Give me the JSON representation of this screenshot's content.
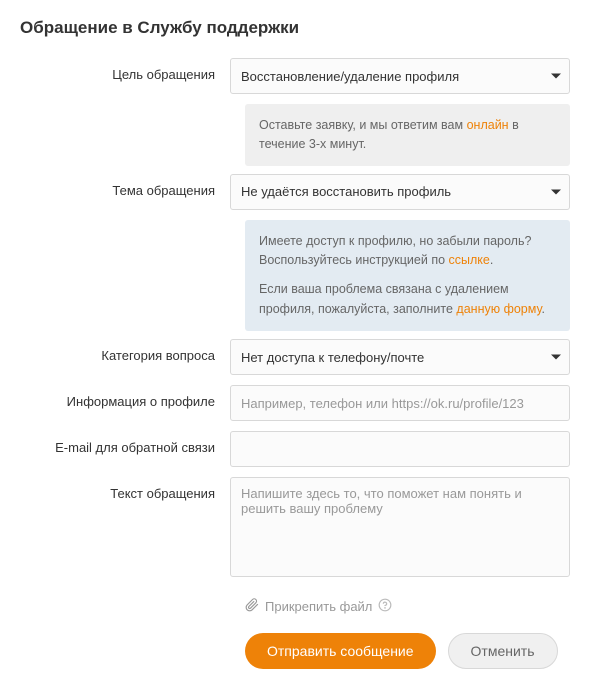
{
  "title": "Обращение в Службу поддержки",
  "fields": {
    "purpose": {
      "label": "Цель обращения",
      "value": "Восстановление/удаление профиля"
    },
    "purpose_note": {
      "text1": "Оставьте заявку, и мы ответим вам ",
      "link": "онлайн",
      "text2": " в течение 3-х минут."
    },
    "subject": {
      "label": "Тема обращения",
      "value": "Не удаётся восстановить профиль"
    },
    "subject_note": {
      "p1a": "Имеете доступ к профилю, но забыли пароль? Воспользуйтесь инструкцией по ",
      "p1link": "ссылке",
      "p1b": ".",
      "p2a": "Если ваша проблема связана с удалением профиля, пожалуйста, заполните ",
      "p2link": "данную форму",
      "p2b": "."
    },
    "category": {
      "label": "Категория вопроса",
      "value": "Нет доступа к телефону/почте"
    },
    "profile_info": {
      "label": "Информация о профиле",
      "placeholder": "Например, телефон или https://ok.ru/profile/123"
    },
    "email": {
      "label": "E-mail для обратной связи"
    },
    "message": {
      "label": "Текст обращения",
      "placeholder": "Напишите здесь то, что поможет нам понять и решить вашу проблему"
    }
  },
  "attach_label": "Прикрепить файл",
  "buttons": {
    "submit": "Отправить сообщение",
    "cancel": "Отменить"
  }
}
